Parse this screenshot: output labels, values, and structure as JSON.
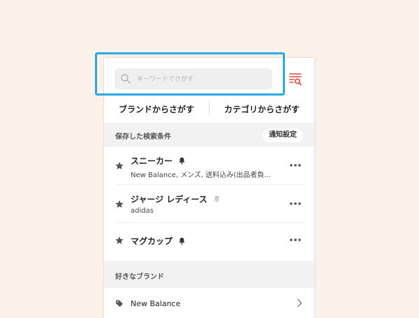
{
  "search": {
    "placeholder": "キーワードでさがす"
  },
  "nav": {
    "brand_tab": "ブランドからさがす",
    "category_tab": "カテゴリからさがす"
  },
  "saved_searches": {
    "title": "保存した検索条件",
    "notify_button": "通知設定",
    "items": [
      {
        "title": "スニーカー",
        "subtitle": "New Balance, メンズ, 送料込み(出品者負...",
        "bell": "bell-on"
      },
      {
        "title": "ジャージ レディース",
        "subtitle": "adidas",
        "bell": "bell-off"
      },
      {
        "title": "マグカップ",
        "subtitle": "",
        "bell": "bell-on"
      }
    ]
  },
  "favorite_brands": {
    "title": "好きなブランド",
    "items": [
      {
        "name": "New Balance"
      }
    ]
  },
  "colors": {
    "accent": "#e0443f",
    "highlight": "#28a9e0",
    "background": "#fdf2ea"
  }
}
